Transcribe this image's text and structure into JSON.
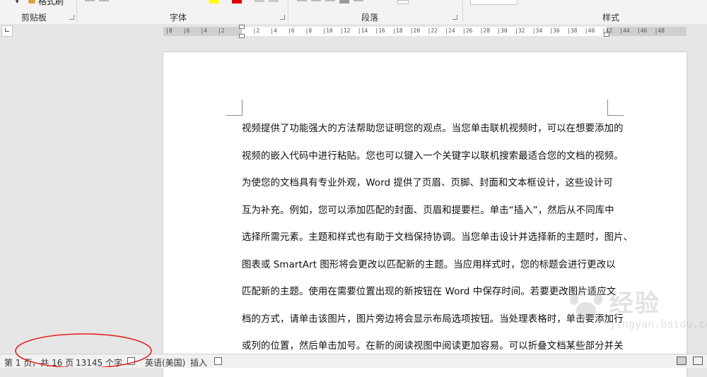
{
  "ribbon": {
    "format_painter_label": "格式刷",
    "groups": {
      "clipboard": "剪贴板",
      "font": "字体",
      "paragraph": "段落",
      "styles": "样式"
    },
    "highlight_color": "#ffff00",
    "font_color": "#e00000"
  },
  "ruler": {
    "tab_selector_glyph": "∟",
    "ticks": [
      "8",
      "6",
      "4",
      "2",
      "",
      "2",
      "4",
      "6",
      "8",
      "10",
      "12",
      "14",
      "16",
      "18",
      "20",
      "22",
      "24",
      "26",
      "28",
      "30",
      "32",
      "34",
      "36",
      "38",
      "40",
      "42",
      "44",
      "46",
      "48"
    ]
  },
  "document": {
    "lines": [
      "视频提供了功能强大的方法帮助您证明您的观点。当您单击联机视频时，可以在想要添加的",
      "视频的嵌入代码中进行粘贴。您也可以键入一个关键字以联机搜索最适合您的文档的视频。",
      "为使您的文档具有专业外观，Word 提供了页眉、页脚、封面和文本框设计，这些设计可",
      "互为补充。例如，您可以添加匹配的封面、页眉和提要栏。单击“插入”，然后从不同库中",
      "选择所需元素。主题和样式也有助于文档保持协调。当您单击设计并选择新的主题时，图片、",
      "图表或 SmartArt 图形将会更改以匹配新的主题。当应用样式时，您的标题会进行更改以",
      "匹配新的主题。使用在需要位置出现的新按钮在 Word 中保存时间。若要更改图片适应文",
      "档的方式，请单击该图片，图片旁边将会显示布局选项按钮。当处理表格时，单击要添加行",
      "或列的位置，然后单击加号。在新的阅读视图中阅读更加容易。可以折叠文档某些部分并关"
    ]
  },
  "watermark": {
    "text": "经验",
    "sub": "jingyan.baidu.com"
  },
  "statusbar": {
    "page": "第 1 页，共 16 页",
    "words": "13145 个字",
    "language": "英语(美国)",
    "mode": "插入"
  },
  "annotation_color": "#e02020"
}
